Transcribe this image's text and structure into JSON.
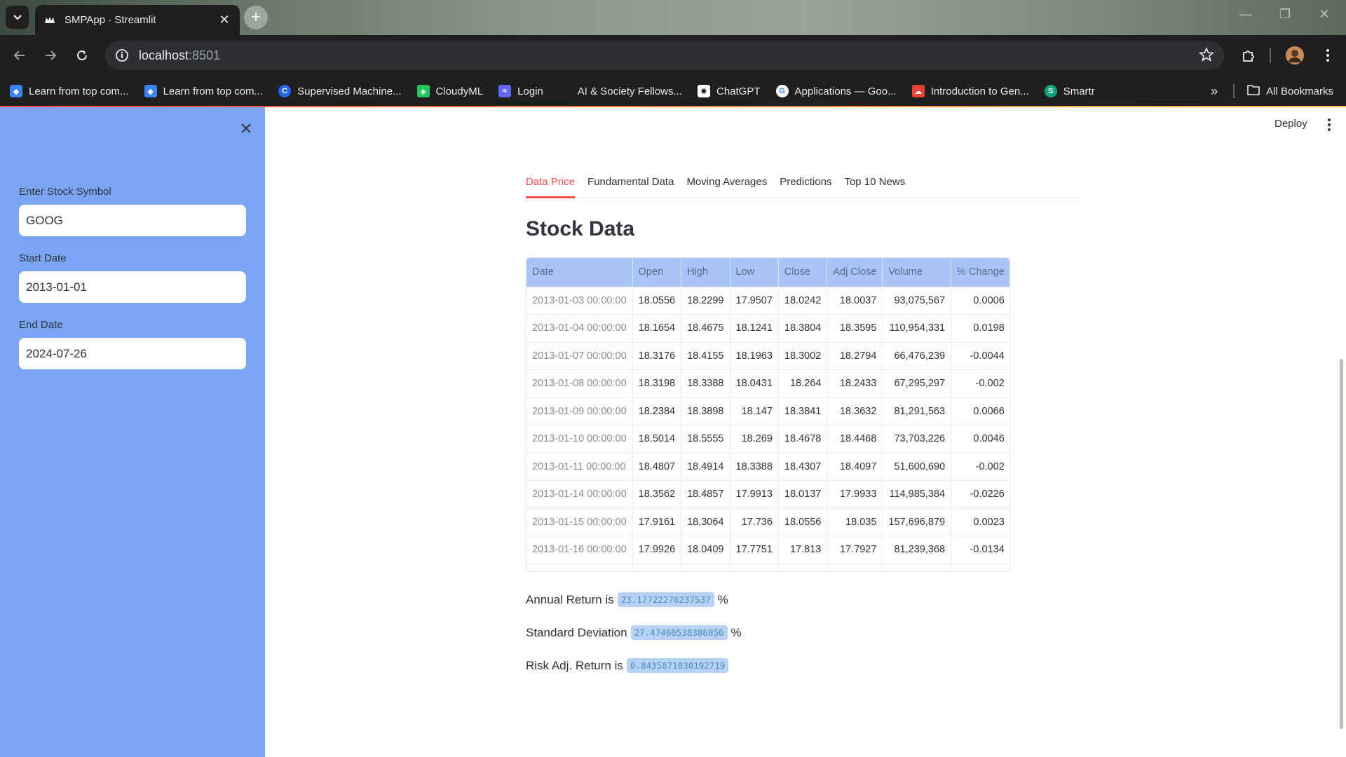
{
  "browser": {
    "tab_title": "SMPApp · Streamlit",
    "url_host": "localhost",
    "url_port": ":8501",
    "bookmarks": [
      {
        "label": "Learn from top com...",
        "icon": "coursera-icon",
        "color": "#3b82f6"
      },
      {
        "label": "Learn from top com...",
        "icon": "coursera-icon",
        "color": "#3b82f6"
      },
      {
        "label": "Supervised Machine...",
        "icon": "c-icon",
        "color": "#2563eb"
      },
      {
        "label": "CloudyML",
        "icon": "cloudyml-icon",
        "color": "#22c55e"
      },
      {
        "label": "Login",
        "icon": "login-icon",
        "color": "#6366f1"
      },
      {
        "label": "AI & Society Fellows...",
        "icon": "microsoft-icon",
        "color": "#f25022"
      },
      {
        "label": "ChatGPT",
        "icon": "chatgpt-icon",
        "color": "#ffffff"
      },
      {
        "label": "Applications — Goo...",
        "icon": "google-icon",
        "color": "#4285f4"
      },
      {
        "label": "Introduction to Gen...",
        "icon": "google-cloud-icon",
        "color": "#ea4335"
      },
      {
        "label": "Smartr",
        "icon": "smartr-icon",
        "color": "#10a37f"
      }
    ],
    "all_bookmarks": "All Bookmarks"
  },
  "sidebar": {
    "symbol_label": "Enter Stock Symbol",
    "symbol_value": "GOOG",
    "start_label": "Start Date",
    "start_value": "2013-01-01",
    "end_label": "End Date",
    "end_value": "2024-07-26"
  },
  "header": {
    "deploy": "Deploy"
  },
  "tabs": [
    "Data Price",
    "Fundamental Data",
    "Moving Averages",
    "Predictions",
    "Top 10 News"
  ],
  "heading": "Stock Data",
  "table": {
    "columns": [
      "Date",
      "Open",
      "High",
      "Low",
      "Close",
      "Adj Close",
      "Volume",
      "% Change"
    ],
    "rows": [
      [
        "2013-01-03 00:00:00",
        "18.0556",
        "18.2299",
        "17.9507",
        "18.0242",
        "18.0037",
        "93,075,567",
        "0.0006"
      ],
      [
        "2013-01-04 00:00:00",
        "18.1654",
        "18.4675",
        "18.1241",
        "18.3804",
        "18.3595",
        "110,954,331",
        "0.0198"
      ],
      [
        "2013-01-07 00:00:00",
        "18.3176",
        "18.4155",
        "18.1963",
        "18.3002",
        "18.2794",
        "66,476,239",
        "-0.0044"
      ],
      [
        "2013-01-08 00:00:00",
        "18.3198",
        "18.3388",
        "18.0431",
        "18.264",
        "18.2433",
        "67,295,297",
        "-0.002"
      ],
      [
        "2013-01-09 00:00:00",
        "18.2384",
        "18.3898",
        "18.147",
        "18.3841",
        "18.3632",
        "81,291,563",
        "0.0066"
      ],
      [
        "2013-01-10 00:00:00",
        "18.5014",
        "18.5555",
        "18.269",
        "18.4678",
        "18.4468",
        "73,703,226",
        "0.0046"
      ],
      [
        "2013-01-11 00:00:00",
        "18.4807",
        "18.4914",
        "18.3388",
        "18.4307",
        "18.4097",
        "51,600,690",
        "-0.002"
      ],
      [
        "2013-01-14 00:00:00",
        "18.3562",
        "18.4857",
        "17.9913",
        "18.0137",
        "17.9933",
        "114,985,384",
        "-0.0226"
      ],
      [
        "2013-01-15 00:00:00",
        "17.9161",
        "18.3064",
        "17.736",
        "18.0556",
        "18.035",
        "157,696,879",
        "0.0023"
      ],
      [
        "2013-01-16 00:00:00",
        "17.9926",
        "18.0409",
        "17.7751",
        "17.813",
        "17.7927",
        "81,239,368",
        "-0.0134"
      ]
    ]
  },
  "metrics": {
    "annual_label": "Annual Return is",
    "annual_value": "23.17722276237537",
    "std_label": "Standard Deviation",
    "std_value": "27.47460538386856",
    "risk_label": "Risk Adj. Return is",
    "risk_value": "0.8435871030192719",
    "percent": "%"
  },
  "colors": {
    "sidebar": "#7aa5f5",
    "accent": "#ff4b4b",
    "table_header": "#a8c4f7"
  }
}
